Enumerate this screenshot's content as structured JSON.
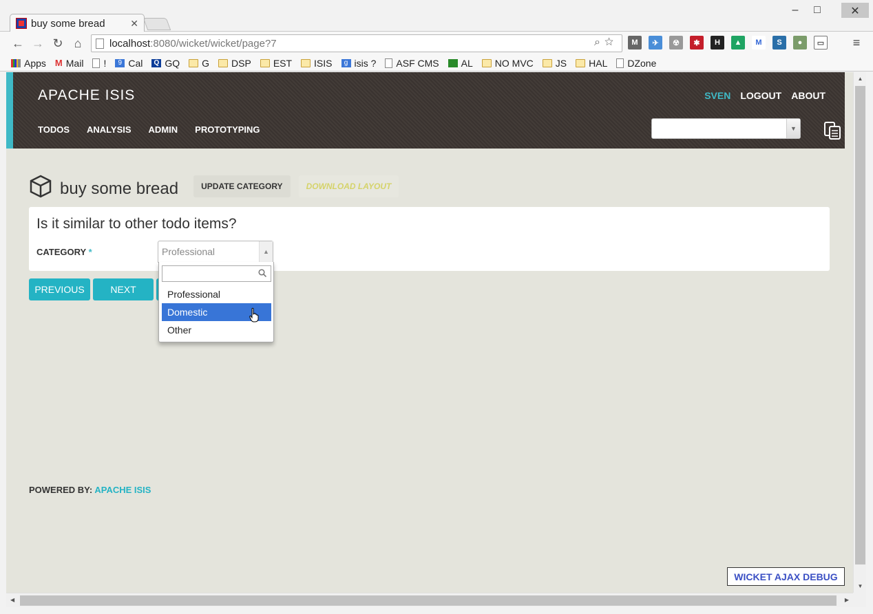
{
  "browser": {
    "tab_title": "buy some bread",
    "url_host": "localhost",
    "url_rest": ":8080/wicket/wicket/page?7",
    "window_controls": [
      "–",
      "□",
      "✕"
    ],
    "bookmarks": [
      {
        "label": "Apps",
        "icon": "apps-icon"
      },
      {
        "label": "Mail",
        "icon": "gmail-icon"
      },
      {
        "label": "!",
        "icon": "page-icon"
      },
      {
        "label": "Cal",
        "icon": "calendar-icon"
      },
      {
        "label": "GQ",
        "icon": "q-icon"
      },
      {
        "label": "G",
        "icon": "folder-icon"
      },
      {
        "label": "DSP",
        "icon": "folder-icon"
      },
      {
        "label": "EST",
        "icon": "folder-icon"
      },
      {
        "label": "ISIS",
        "icon": "folder-icon"
      },
      {
        "label": "isis ?",
        "icon": "google-icon"
      },
      {
        "label": "ASF CMS",
        "icon": "page-icon"
      },
      {
        "label": "AL",
        "icon": "shamrock-icon"
      },
      {
        "label": "NO MVC",
        "icon": "folder-icon"
      },
      {
        "label": "JS",
        "icon": "folder-icon"
      },
      {
        "label": "HAL",
        "icon": "folder-icon"
      },
      {
        "label": "DZone",
        "icon": "page-icon"
      }
    ]
  },
  "app": {
    "brand": "APACHE ISIS",
    "menu": [
      "TODOS",
      "ANALYSIS",
      "ADMIN",
      "PROTOTYPING"
    ],
    "user": "SVEN",
    "logout": "LOGOUT",
    "about": "ABOUT"
  },
  "page": {
    "title": "buy some bread",
    "actions": {
      "update_category": "UPDATE CATEGORY",
      "download_layout": "DOWNLOAD LAYOUT"
    },
    "question": "Is it similar to other todo items?",
    "field_label": "CATEGORY",
    "required_mark": "*",
    "selected_value": "Professional",
    "options": [
      "Professional",
      "Domestic",
      "Other"
    ],
    "highlighted_option": "Domestic",
    "buttons": {
      "previous": "PREVIOUS",
      "next": "NEXT"
    }
  },
  "footer": {
    "powered_by": "POWERED BY:",
    "link": "APACHE ISIS"
  },
  "debug_button": "WICKET AJAX DEBUG",
  "colors": {
    "accent": "#24b3c4",
    "navbar": "#3d3632",
    "highlight": "#3875d7",
    "background": "#e4e4dc"
  }
}
